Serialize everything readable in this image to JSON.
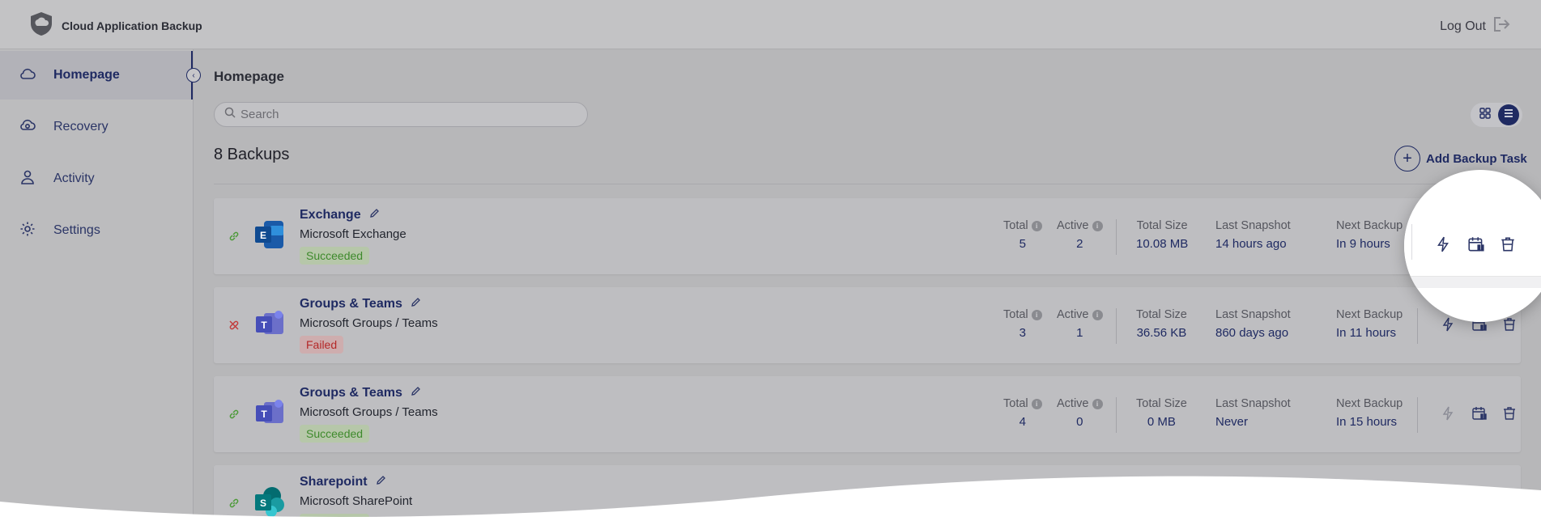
{
  "app": {
    "title": "Cloud Application Backup",
    "logout_label": "Log Out"
  },
  "sidebar": {
    "items": [
      {
        "label": "Homepage",
        "icon": "cloud-icon",
        "active": true
      },
      {
        "label": "Recovery",
        "icon": "cloud-restore-icon",
        "active": false
      },
      {
        "label": "Activity",
        "icon": "user-icon",
        "active": false
      },
      {
        "label": "Settings",
        "icon": "gear-icon",
        "active": false
      }
    ]
  },
  "main": {
    "title": "Homepage",
    "search_placeholder": "Search",
    "count_label": "8 Backups",
    "add_task_label": "Add Backup Task",
    "view_mode": "list"
  },
  "labels": {
    "total": "Total",
    "active": "Active",
    "total_size": "Total Size",
    "last_snapshot": "Last Snapshot",
    "next_backup": "Next Backup"
  },
  "backups": [
    {
      "name": "Exchange",
      "type": "Microsoft Exchange",
      "status": "Succeeded",
      "total": "5",
      "active": "2",
      "size": "10.08 MB",
      "last_snapshot": "14 hours ago",
      "next_backup": "In 9 hours",
      "linked": true,
      "app_icon": "exchange-icon"
    },
    {
      "name": "Groups & Teams",
      "type": "Microsoft Groups / Teams",
      "status": "Failed",
      "total": "3",
      "active": "1",
      "size": "36.56 KB",
      "last_snapshot": "860 days ago",
      "next_backup": "In 11 hours",
      "linked": false,
      "app_icon": "teams-icon"
    },
    {
      "name": "Groups & Teams",
      "type": "Microsoft Groups / Teams",
      "status": "Succeeded",
      "total": "4",
      "active": "0",
      "size": "0 MB",
      "last_snapshot": "Never",
      "next_backup": "In 15 hours",
      "linked": true,
      "app_icon": "teams-icon"
    },
    {
      "name": "Sharepoint",
      "type": "Microsoft SharePoint",
      "status": "Succeeded",
      "linked": true,
      "app_icon": "sharepoint-icon"
    }
  ],
  "colors": {
    "brand": "#1f2a62",
    "success": "#3e8a2c",
    "danger": "#b42828",
    "overlay_bg": "#b7b7b9"
  }
}
